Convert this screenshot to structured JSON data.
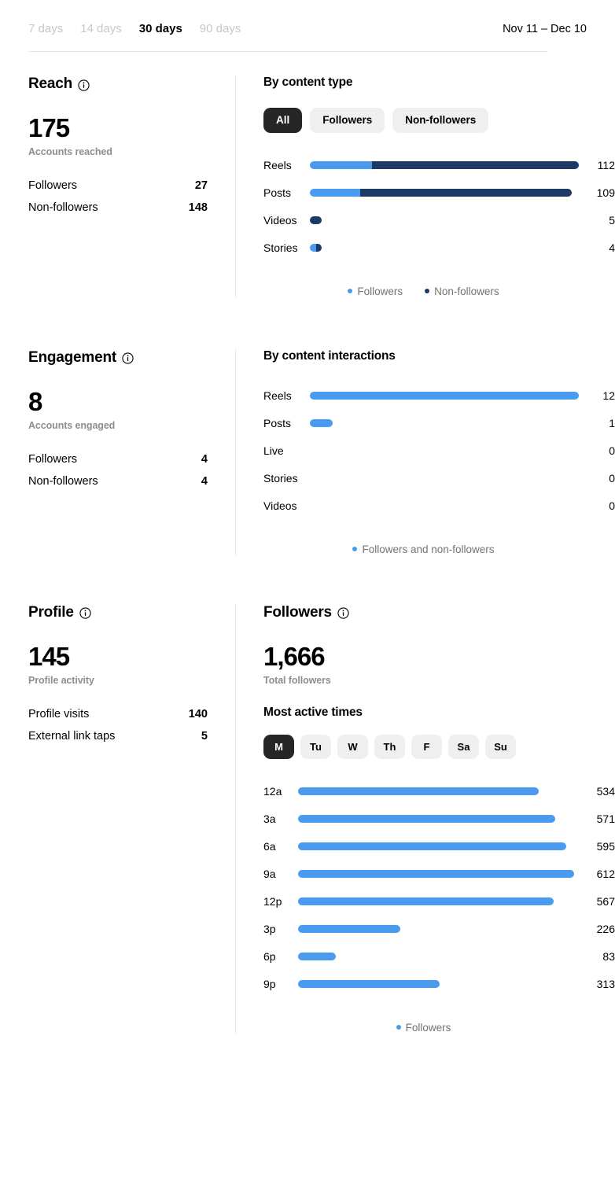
{
  "header": {
    "range_tabs": [
      {
        "label": "7 days",
        "active": false
      },
      {
        "label": "14 days",
        "active": false
      },
      {
        "label": "30 days",
        "active": true
      },
      {
        "label": "90 days",
        "active": false
      }
    ],
    "date_range": "Nov 11 – Dec 10"
  },
  "colors": {
    "followers": "#4a9bf0",
    "non_followers": "#1b3a66",
    "pill_active_bg": "#262626",
    "pill_bg": "#efefef",
    "muted_text": "#8e8e8e"
  },
  "icons": {
    "info": "info-icon"
  },
  "reach": {
    "title": "Reach",
    "total": "175",
    "total_label": "Accounts reached",
    "breakdown": [
      {
        "label": "Followers",
        "value": "27"
      },
      {
        "label": "Non-followers",
        "value": "148"
      }
    ],
    "panel_title": "By content type",
    "filters": [
      {
        "label": "All",
        "active": true
      },
      {
        "label": "Followers",
        "active": false
      },
      {
        "label": "Non-followers",
        "active": false
      }
    ],
    "legend": [
      {
        "label": "Followers",
        "color": "#4a9bf0"
      },
      {
        "label": "Non-followers",
        "color": "#1b3a66"
      }
    ]
  },
  "engagement": {
    "title": "Engagement",
    "total": "8",
    "total_label": "Accounts engaged",
    "breakdown": [
      {
        "label": "Followers",
        "value": "4"
      },
      {
        "label": "Non-followers",
        "value": "4"
      }
    ],
    "panel_title": "By content interactions",
    "legend": [
      {
        "label": "Followers and non-followers",
        "color": "#4a9bf0"
      }
    ]
  },
  "profile": {
    "title": "Profile",
    "total": "145",
    "total_label": "Profile activity",
    "breakdown": [
      {
        "label": "Profile visits",
        "value": "140"
      },
      {
        "label": "External link taps",
        "value": "5"
      }
    ]
  },
  "followers": {
    "title": "Followers",
    "total": "1,666",
    "total_label": "Total followers",
    "panel_title": "Most active times",
    "days": [
      {
        "label": "M",
        "active": true
      },
      {
        "label": "Tu",
        "active": false
      },
      {
        "label": "W",
        "active": false
      },
      {
        "label": "Th",
        "active": false
      },
      {
        "label": "F",
        "active": false
      },
      {
        "label": "Sa",
        "active": false
      },
      {
        "label": "Su",
        "active": false
      }
    ],
    "legend": [
      {
        "label": "Followers",
        "color": "#4a9bf0"
      }
    ]
  },
  "chart_data": [
    {
      "type": "bar",
      "id": "reach-by-content-type",
      "title": "By content type",
      "orientation": "horizontal",
      "stacked": true,
      "categories": [
        "Reels",
        "Posts",
        "Videos",
        "Stories"
      ],
      "series": [
        {
          "name": "Followers",
          "color": "#4a9bf0",
          "values": [
            26,
            21,
            0,
            2
          ]
        },
        {
          "name": "Non-followers",
          "color": "#1b3a66",
          "values": [
            86,
            88,
            5,
            2
          ]
        }
      ],
      "totals": [
        112,
        109,
        5,
        4
      ],
      "value_labels": [
        "112",
        "109",
        "5",
        "4"
      ],
      "max_value": 112,
      "xlabel": "",
      "ylabel": "",
      "grid": false,
      "legend_position": "bottom"
    },
    {
      "type": "bar",
      "id": "engagement-by-content-interactions",
      "title": "By content interactions",
      "orientation": "horizontal",
      "stacked": false,
      "categories": [
        "Reels",
        "Posts",
        "Live",
        "Stories",
        "Videos"
      ],
      "series": [
        {
          "name": "Followers and non-followers",
          "color": "#4a9bf0",
          "values": [
            12,
            1,
            0,
            0,
            0
          ]
        }
      ],
      "value_labels": [
        "12",
        "1",
        "0",
        "0",
        "0"
      ],
      "max_value": 12,
      "xlabel": "",
      "ylabel": "",
      "grid": false,
      "legend_position": "bottom"
    },
    {
      "type": "bar",
      "id": "followers-most-active-times",
      "title": "Most active times",
      "subtitle": "M",
      "orientation": "horizontal",
      "stacked": false,
      "categories": [
        "12a",
        "3a",
        "6a",
        "9a",
        "12p",
        "3p",
        "6p",
        "9p"
      ],
      "series": [
        {
          "name": "Followers",
          "color": "#4a9bf0",
          "values": [
            534,
            571,
            595,
            612,
            567,
            226,
            83,
            313
          ]
        }
      ],
      "value_labels": [
        "534",
        "571",
        "595",
        "612",
        "567",
        "226",
        "83",
        "313"
      ],
      "max_value": 612,
      "xlabel": "",
      "ylabel": "",
      "grid": false,
      "legend_position": "bottom"
    }
  ]
}
